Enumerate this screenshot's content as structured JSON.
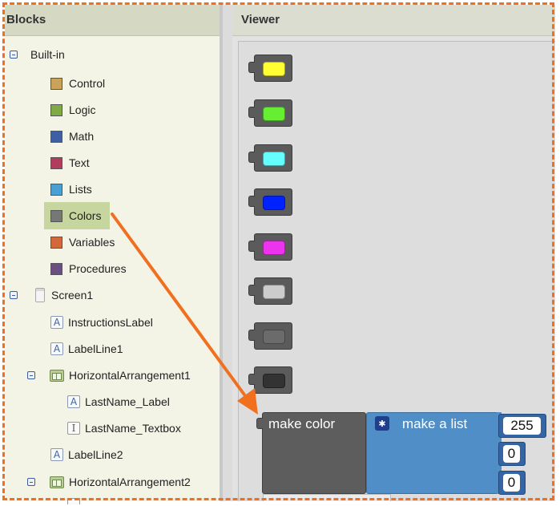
{
  "blocks_panel": {
    "title": "Blocks",
    "built_in": {
      "label": "Built-in",
      "items": [
        {
          "label": "Control",
          "color": "#c9a35a"
        },
        {
          "label": "Logic",
          "color": "#7eab46"
        },
        {
          "label": "Math",
          "color": "#3f5fa3"
        },
        {
          "label": "Text",
          "color": "#b03d5e"
        },
        {
          "label": "Lists",
          "color": "#4a9fd3"
        },
        {
          "label": "Colors",
          "color": "#777777"
        },
        {
          "label": "Variables",
          "color": "#d3683a"
        },
        {
          "label": "Procedures",
          "color": "#6b4f82"
        }
      ]
    },
    "screen": {
      "label": "Screen1",
      "components": {
        "instructions_label": "InstructionsLabel",
        "label_line1": "LabelLine1",
        "horizontal_arrangement1": "HorizontalArrangement1",
        "lastname_label": "LastName_Label",
        "lastname_textbox": "LastName_Textbox",
        "label_line2": "LabelLine2",
        "horizontal_arrangement2": "HorizontalArrangement2"
      }
    }
  },
  "viewer": {
    "title": "Viewer",
    "color_blocks": [
      {
        "name": "yellow",
        "color": "#ffff33"
      },
      {
        "name": "green",
        "color": "#66ee33"
      },
      {
        "name": "cyan",
        "color": "#66ffff"
      },
      {
        "name": "blue",
        "color": "#0022ff"
      },
      {
        "name": "magenta",
        "color": "#ee33ee"
      },
      {
        "name": "light-gray",
        "color": "#cccccc"
      },
      {
        "name": "gray",
        "color": "#6b6b6b"
      },
      {
        "name": "dark-gray",
        "color": "#333333"
      }
    ],
    "make_color_label": "make color",
    "make_list_label": "make a list",
    "values": [
      "255",
      "0",
      "0"
    ]
  },
  "accent_colors": {
    "highlight_frame": "#f07020",
    "arrow": "#f07020",
    "selected_item": "#c7d59f"
  }
}
